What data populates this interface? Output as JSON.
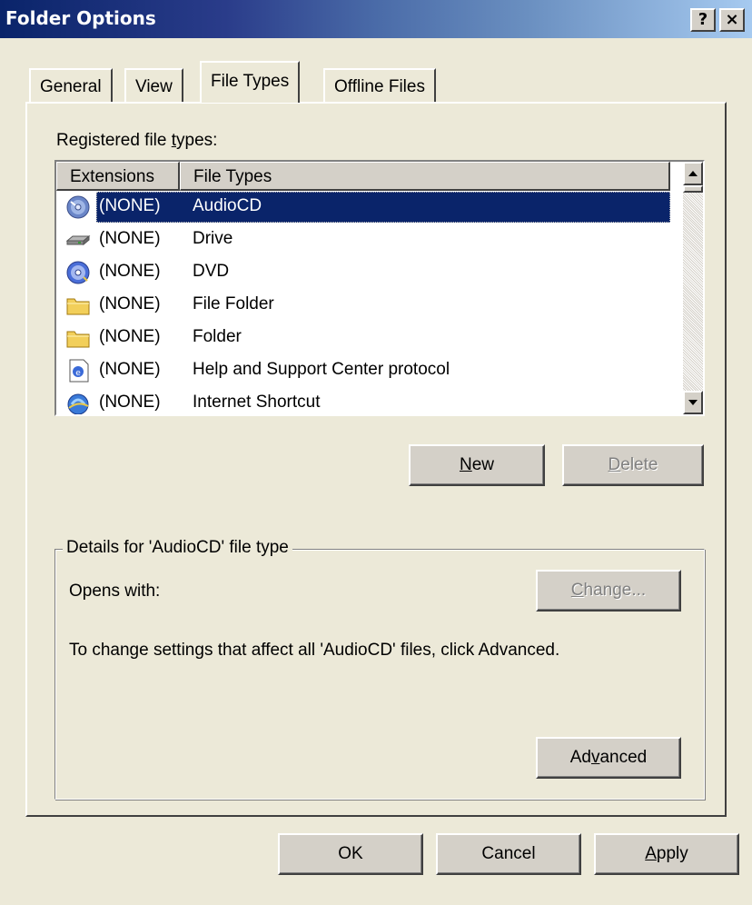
{
  "window": {
    "title": "Folder Options",
    "help_glyph": "?",
    "close_glyph": "×"
  },
  "tabs": [
    {
      "label": "General"
    },
    {
      "label": "View"
    },
    {
      "label": "File Types"
    },
    {
      "label": "Offline Files"
    }
  ],
  "file_types": {
    "registered_label_pre": "Registered file ",
    "registered_label_accel": "t",
    "registered_label_post": "ypes:",
    "columns": [
      "Extensions",
      "File Types"
    ],
    "rows": [
      {
        "icon": "audio-cd-icon",
        "ext": "(NONE)",
        "type": "AudioCD"
      },
      {
        "icon": "drive-icon",
        "ext": "(NONE)",
        "type": "Drive"
      },
      {
        "icon": "dvd-icon",
        "ext": "(NONE)",
        "type": "DVD"
      },
      {
        "icon": "file-folder-icon",
        "ext": "(NONE)",
        "type": "File Folder"
      },
      {
        "icon": "folder-icon",
        "ext": "(NONE)",
        "type": "Folder"
      },
      {
        "icon": "help-support-icon",
        "ext": "(NONE)",
        "type": "Help and Support Center protocol"
      },
      {
        "icon": "internet-shortcut-icon",
        "ext": "(NONE)",
        "type": "Internet Shortcut"
      }
    ],
    "new_accel": "N",
    "new_rest": "ew",
    "delete_accel": "D",
    "delete_rest": "elete"
  },
  "details": {
    "title": "Details for 'AudioCD' file type",
    "opens_with": "Opens with:",
    "change_accel": "C",
    "change_rest": "hange...",
    "info": "To change settings that affect all 'AudioCD' files, click Advanced.",
    "advanced_pre": "Ad",
    "advanced_accel": "v",
    "advanced_post": "anced"
  },
  "footer": {
    "ok": "OK",
    "cancel": "Cancel",
    "apply_accel": "A",
    "apply_rest": "pply"
  },
  "colors": {
    "face": "#ECE9D8",
    "selection": "#0A246A",
    "title_start": "#0A246A",
    "title_end": "#A6CAF0"
  }
}
